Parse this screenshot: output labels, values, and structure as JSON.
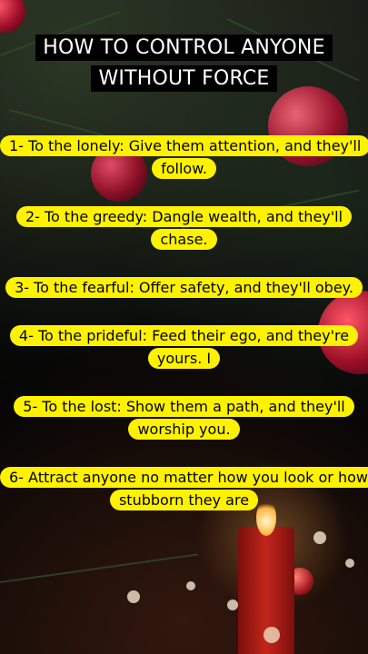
{
  "title": "HOW TO CONTROL ANYONE WITHOUT FORCE",
  "items": [
    "1- To the lonely: Give them attention, and they'll follow.",
    "2- To the greedy: Dangle wealth, and they'll chase.",
    "3- To the fearful: Offer safety, and they'll obey.",
    "4- To the prideful: Feed their ego, and they're yours. I",
    "5- To the lost: Show them a path, and they'll worship you.",
    "6- Attract anyone no matter how you look or how stubborn they are"
  ],
  "colors": {
    "highlight": "#fff200",
    "title_bg": "#000000",
    "accent": "#a5122e"
  }
}
